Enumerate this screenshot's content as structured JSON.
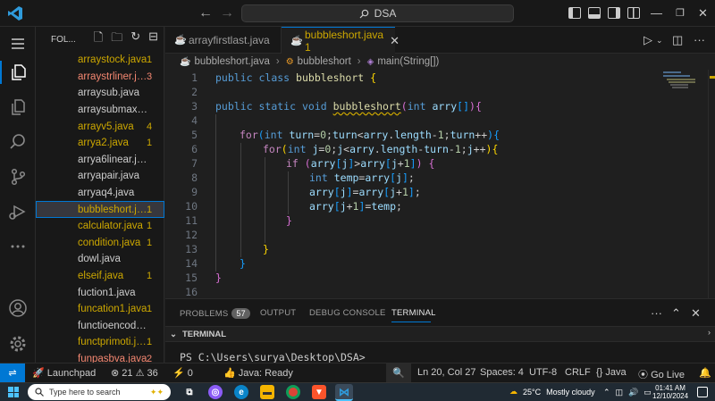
{
  "title_bar": {
    "search_text": "DSA"
  },
  "sidebar": {
    "header_label": "FOL...",
    "files": [
      {
        "name": "arraystock.java",
        "badge": "1",
        "status": "warn"
      },
      {
        "name": "arraystrliner.java",
        "badge": "3",
        "status": "err"
      },
      {
        "name": "arraysub.java",
        "badge": "",
        "status": "default"
      },
      {
        "name": "arraysubmax.java",
        "badge": "",
        "status": "default"
      },
      {
        "name": "arrayv5.java",
        "badge": "4",
        "status": "warn"
      },
      {
        "name": "arrya2.java",
        "badge": "1",
        "status": "warn"
      },
      {
        "name": "arrya6linear.java",
        "badge": "",
        "status": "default"
      },
      {
        "name": "arryapair.java",
        "badge": "",
        "status": "default"
      },
      {
        "name": "arryaq4.java",
        "badge": "",
        "status": "default"
      },
      {
        "name": "bubbleshort.java",
        "badge": "1",
        "status": "warn",
        "selected": true
      },
      {
        "name": "calculator.java",
        "badge": "1",
        "status": "warn"
      },
      {
        "name": "condition.java",
        "badge": "1",
        "status": "warn"
      },
      {
        "name": "dowl.java",
        "badge": "",
        "status": "default"
      },
      {
        "name": "elseif.java",
        "badge": "1",
        "status": "warn"
      },
      {
        "name": "fuction1.java",
        "badge": "",
        "status": "default"
      },
      {
        "name": "funcation1.java",
        "badge": "1",
        "status": "warn"
      },
      {
        "name": "functioencode.java",
        "badge": "",
        "status": "default"
      },
      {
        "name": "functprimoti.java",
        "badge": "1",
        "status": "warn"
      },
      {
        "name": "funpasbva.java",
        "badge": "2",
        "status": "err"
      }
    ]
  },
  "tabs": [
    {
      "label": "arrayfirstlast.java"
    },
    {
      "label": "bubbleshort.java 1",
      "active": true
    }
  ],
  "breadcrumb": {
    "file": "bubbleshort.java",
    "class": "bubbleshort",
    "method": "main(String[])"
  },
  "editor": {
    "line_numbers": [
      "1",
      "2",
      "3",
      "4",
      "5",
      "6",
      "7",
      "8",
      "9",
      "10",
      "11",
      "12",
      "13",
      "14",
      "15",
      "16"
    ]
  },
  "panel": {
    "tabs": [
      {
        "label": "PROBLEMS",
        "badge": "57"
      },
      {
        "label": "OUTPUT"
      },
      {
        "label": "DEBUG CONSOLE"
      },
      {
        "label": "TERMINAL",
        "active": true
      }
    ],
    "section_title": "TERMINAL",
    "prompt": "PS C:\\Users\\surya\\Desktop\\DSA>"
  },
  "status_bar": {
    "launchpad": "Launchpad",
    "errors": "21",
    "warnings": "36",
    "ports": "0",
    "java_status": "Java: Ready",
    "cursor": "Ln 20, Col 27",
    "spaces": "Spaces: 4",
    "encoding": "UTF-8",
    "eol": "CRLF",
    "language": "Java",
    "golive": "Go Live"
  },
  "taskbar": {
    "search_placeholder": "Type here to search",
    "weather_temp": "25°C",
    "weather_desc": "Mostly cloudy",
    "time": "01:41 AM",
    "date": "12/10/2024"
  }
}
